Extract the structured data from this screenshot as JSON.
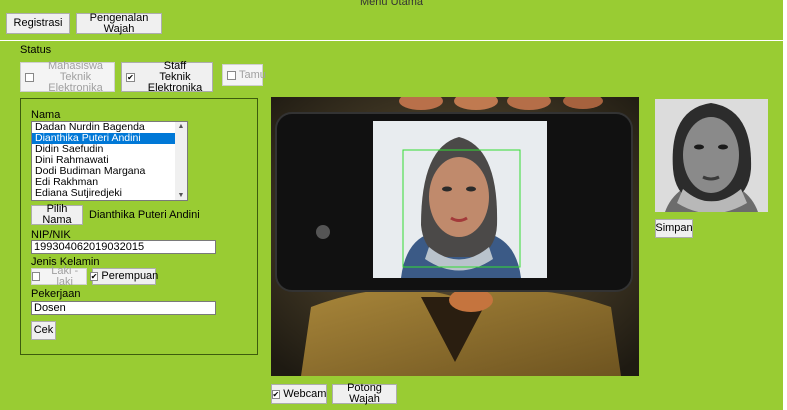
{
  "window": {
    "title": "Menu Utama"
  },
  "toolbar": {
    "registrasi": "Registrasi",
    "pengenalan_wajah": "Pengenalan Wajah"
  },
  "status": {
    "label": "Status",
    "mahasiswa": {
      "line1": "Mahasiswa",
      "line2": "Teknik Elektronika",
      "checked": false,
      "enabled": false
    },
    "staff": {
      "line1": "Staff",
      "line2": "Teknik Elektronika",
      "checked": true,
      "enabled": true
    },
    "tamu": {
      "label": "Tamu",
      "checked": false,
      "enabled": false
    }
  },
  "form": {
    "nama_label": "Nama",
    "names": [
      "Dadan Nurdin Bagenda",
      "Dianthika Puteri Andini",
      "Didin Saefudin",
      "Dini Rahmawati",
      "Dodi Budiman Margana",
      "Edi Rakhman",
      "Ediana Sutjiredjeki"
    ],
    "selected_index": 1,
    "pilih_nama_button": "Pilih Nama",
    "selected_name": "Dianthika Puteri Andini",
    "nip_label": "NIP/NIK",
    "nip_value": "199304062019032015",
    "jenis_kelamin_label": "Jenis Kelamin",
    "laki_laki": "Laki - laki",
    "perempuan": "Perempuan",
    "pekerjaan_label": "Pekerjaan",
    "pekerjaan_value": "Dosen",
    "cek_button": "Cek"
  },
  "camera": {
    "webcam_label": "Webcam",
    "webcam_checked": true,
    "potong_wajah_button": "Potong Wajah"
  },
  "preview": {
    "simpan_button": "Simpan"
  },
  "colors": {
    "background": "#99cc33",
    "selection": "#0078d7",
    "face_box": "#33dd33"
  },
  "icons": {
    "check": "check-mark-icon",
    "scroll_up": "scroll-up-arrow-icon",
    "scroll_down": "scroll-down-arrow-icon"
  }
}
